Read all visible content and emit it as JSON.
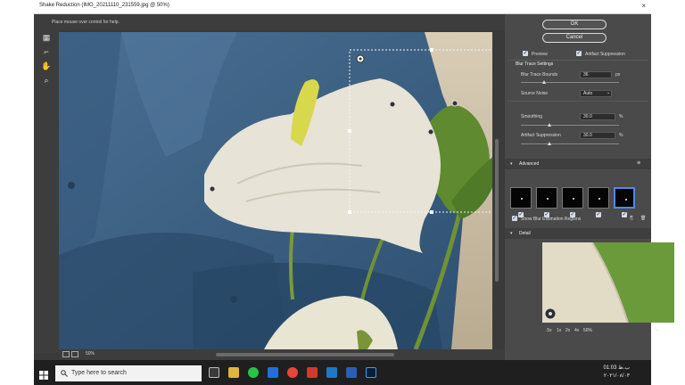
{
  "window": {
    "title": "Shake Reduction (IMG_20211110_231559.jpg @ 50%)",
    "close": "×",
    "hint": "Place mouse over control for help."
  },
  "panel": {
    "ok": "OK",
    "cancel": "Cancel",
    "preview_label": "Preview",
    "artifact_label": "Artifact Suppression",
    "blur_section": "Blur Trace Settings",
    "bounds_label": "Blur Trace Bounds",
    "bounds_value": "36",
    "bounds_unit": "px",
    "noise_label": "Source Noise",
    "noise_value": "Auto",
    "smoothing_label": "Smoothing",
    "smoothing_value": "30.0",
    "smoothing_unit": "%",
    "suppression_label": "Artifact Suppression",
    "suppression_value": "30.0",
    "suppression_unit": "%",
    "advanced_label": "Advanced",
    "show_regions_label": "Show Blur Estimation Regions",
    "detail_label": "Detail",
    "detail_zoom_options": [
      ".5x",
      "1x",
      "2x",
      "4x",
      "50%"
    ]
  },
  "status": {
    "zoom": "50%",
    "info": "Place mouse over control for help."
  },
  "taskbar": {
    "search_placeholder": "Type here to search",
    "time": "01:03 ب.ظ",
    "date": "۲۰۲۱/۰۸/۰۳"
  },
  "colors": {
    "accent": "#4d8ae8",
    "warning": "#f0b400",
    "panel_bg": "#4a4a4a"
  }
}
